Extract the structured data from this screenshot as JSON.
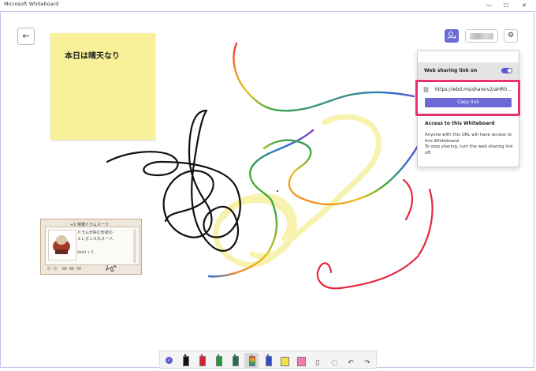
{
  "window": {
    "title": "Microsoft Whiteboard",
    "controls": {
      "minimize": "—",
      "maximize": "☐",
      "close": "✕"
    }
  },
  "canvas": {
    "back_icon": "←",
    "sticky_note": {
      "text": "本日は晴天なり",
      "color": "#f8f199"
    },
    "pasted_image": {
      "header": "+1 特選ドラムスーツ",
      "description_line1": "ドラムが好む形状の",
      "description_line2": "エレガンスなスーツ。",
      "stat": "Mdef + 5"
    }
  },
  "top_actions": {
    "invite_icon": "person-add-icon",
    "avatar_icon": "avatar-blurred",
    "settings_icon": "gear-icon"
  },
  "share_panel": {
    "sharing_label": "Web sharing link on",
    "toggle_on": true,
    "link_url": "https://wbd.ms/share/v2/aHR0...",
    "copy_button": "Copy link",
    "access_title": "Access to this Whiteboard",
    "access_text_1": "Anyone with this URL will have access to this Whiteboard.",
    "access_text_2": "To stop sharing, turn the web sharing link off.",
    "accent_color": "#6b69d6",
    "highlight_color": "#e8336a"
  },
  "toolbar": {
    "tools": [
      {
        "name": "select",
        "icon": "check-circle-icon"
      },
      {
        "name": "pen-black",
        "color": "#111111"
      },
      {
        "name": "pen-red",
        "color": "#d0212f"
      },
      {
        "name": "pen-green",
        "color": "#1f9a3a"
      },
      {
        "name": "pen-darkgreen",
        "color": "#19744a"
      },
      {
        "name": "pen-rainbow",
        "color": "#e0a21a",
        "selected": true
      },
      {
        "name": "pen-blue",
        "color": "#2f4fc0"
      },
      {
        "name": "highlighter-yellow",
        "color": "#f4e04a"
      },
      {
        "name": "highlighter-pink",
        "color": "#f07fb0"
      },
      {
        "name": "ruler",
        "icon": "ruler-icon"
      },
      {
        "name": "lasso",
        "icon": "lasso-icon"
      },
      {
        "name": "undo",
        "icon": "undo-icon"
      },
      {
        "name": "redo",
        "icon": "redo-icon"
      }
    ]
  }
}
